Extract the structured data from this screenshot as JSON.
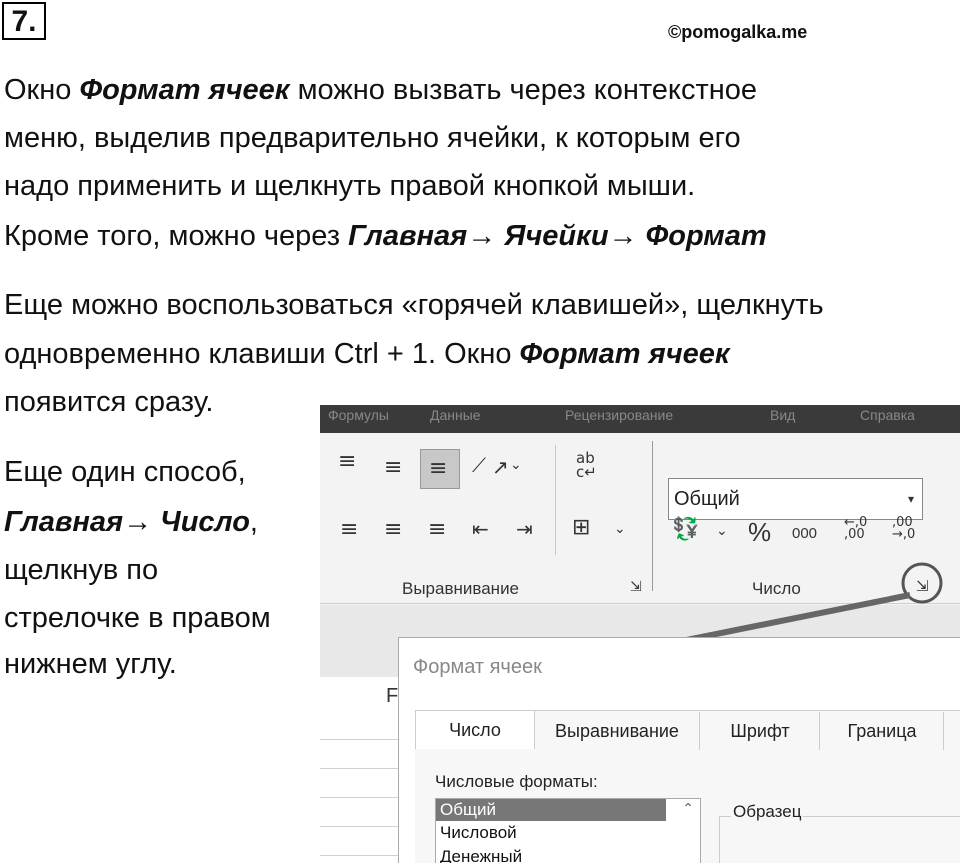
{
  "header": {
    "task_number": "7.",
    "watermark": "©pomogalka.me"
  },
  "paragraph1": {
    "line1_pre": "Окно ",
    "line1_bold": "Формат ячеек",
    "line1_post": " можно вызвать через контекстное",
    "line2": "меню, выделив предварительно ячейки, к которым его",
    "line3": "надо применить и щелкнуть правой кнопкой мыши.",
    "line4_pre": "Кроме того, можно через ",
    "line4_bold": "Главная→ Ячейки→ Формат"
  },
  "paragraph2": {
    "line1": "Еще можно воспользоваться «горячей клавишей», щелкнуть",
    "line2_pre": "одновременно клавиши Ctrl + 1. Окно ",
    "line2_bold": "Формат ячеек",
    "line3": "появится сразу."
  },
  "paragraph3": {
    "line1": "Еще один способ,",
    "line2_bold": "Главная→  Число",
    "line2_post": ",",
    "line3": "щелкнув по",
    "line4": "стрелочке в правом",
    "line5": "нижнем углу."
  },
  "screenshot": {
    "menu_tabs": [
      "Формулы",
      "Данные",
      "Рецензирование",
      "Вид",
      "Справка"
    ],
    "alignment_group_label": "Выравнивание",
    "number_group_label": "Число",
    "number_format_value": "Общий",
    "percent_symbol": "%",
    "thousands_symbol": "000",
    "column_letter": "F",
    "dialog": {
      "title": "Формат ячеек",
      "tabs": [
        "Число",
        "Выравнивание",
        "Шрифт",
        "Граница"
      ],
      "formats_label": "Числовые форматы:",
      "formats": [
        "Общий",
        "Числовой",
        "Денежный"
      ],
      "sample_label": "Образец"
    }
  },
  "colors": {
    "text": "#111111",
    "ribbon_bg": "#f3f3f3",
    "ribbon_top_bg": "#3a3a3a",
    "arrow": "#666666",
    "selected_item": "#777777"
  }
}
